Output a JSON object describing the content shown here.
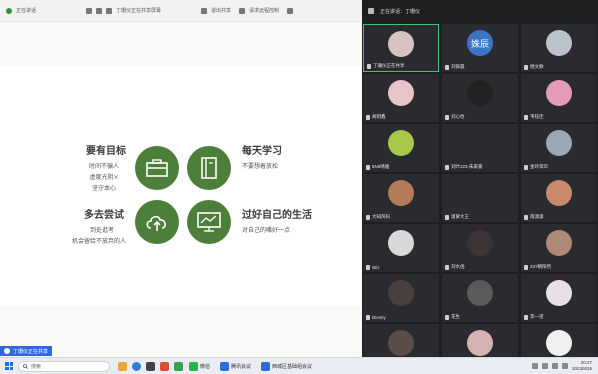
{
  "share": {
    "toolbar": {
      "left_title": "正在讲话",
      "center_title": "丁珊仪正在共享屏幕",
      "btn1": "退出共享",
      "btn2": "请求远程控制"
    },
    "slide": {
      "items": [
        {
          "heading": "要有目标",
          "lines": [
            "时间不骗人",
            "虚度光阴×",
            "坚守本心"
          ]
        },
        {
          "heading": "每天学习",
          "lines": [
            "不要想着放松"
          ]
        },
        {
          "heading": "多去尝试",
          "lines": [
            "到处逛考",
            "机会留给不放弃的人"
          ]
        },
        {
          "heading": "过好自己的生活",
          "lines": [
            "对自己的嘴好一点"
          ]
        }
      ]
    },
    "sharer_label": "丁珊仪正在共享"
  },
  "gallery": {
    "header": {
      "speaking_label": "正在讲话：丁珊仪"
    },
    "participants": [
      {
        "name": "丁珊仪正在共享",
        "color": "#d9c3c0",
        "active": true
      },
      {
        "name": "刘舜晨",
        "text_avatar": "姝辰",
        "color": "#3b73c7"
      },
      {
        "name": "杨文静",
        "color": "#b9c3c9"
      },
      {
        "name": "胡玥鑫",
        "color": "#e7c4c6"
      },
      {
        "name": "刘心怡",
        "color": "#222222"
      },
      {
        "name": "韦钰佳",
        "color": "#e59bb5"
      },
      {
        "name": "5N6晴雅",
        "color": "#a8c74a"
      },
      {
        "name": "刘叶223-朱家豪",
        "color": "#2a2b2e"
      },
      {
        "name": "金玲萍华",
        "color": "#9aa7b5"
      },
      {
        "name": "大知风码",
        "color": "#b57a57"
      },
      {
        "name": "潇萝大王",
        "color": "#2a2b2e"
      },
      {
        "name": "雨潇潇",
        "color": "#c88a6a"
      },
      {
        "name": "Wiz",
        "color": "#d8d8d8"
      },
      {
        "name": "刘水函",
        "color": "#3b3434"
      },
      {
        "name": "23?朝阳然",
        "color": "#b08878"
      },
      {
        "name": "Dienity",
        "color": "#4a3f3f"
      },
      {
        "name": "花生",
        "color": "#5a5a5a"
      },
      {
        "name": "李一诺",
        "color": "#e8e0e6"
      },
      {
        "name": "",
        "color": "#5b4d4a"
      },
      {
        "name": "",
        "color": "#d7b2b2"
      },
      {
        "name": "",
        "color": "#f0f0f0"
      }
    ]
  },
  "taskbar": {
    "search_placeholder": "搜索",
    "app1": "微信",
    "app2": "腾讯会议",
    "app3": "西城区基础组会议",
    "time": "20:27",
    "date": "2023/8/26"
  }
}
